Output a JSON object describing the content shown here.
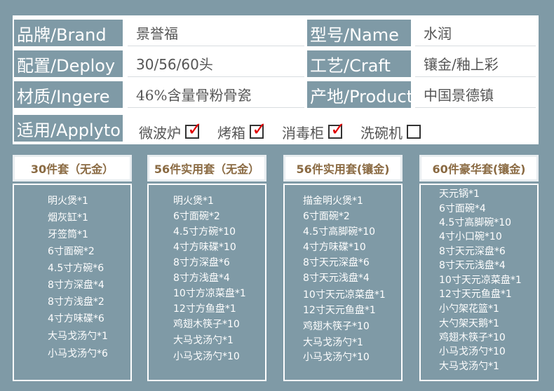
{
  "spec": {
    "brand": {
      "label": "品牌/Brand",
      "value": "景誉福"
    },
    "name": {
      "label": "型号/Name",
      "value": "水润"
    },
    "deploy": {
      "label": "配置/Deploy",
      "value": "30/56/60头"
    },
    "craft": {
      "label": "工艺/Craft",
      "value": "镶金/釉上彩"
    },
    "ingere": {
      "label": "材质/Ingere",
      "value": "46%含量骨粉骨瓷"
    },
    "product": {
      "label": "产地/Product",
      "value": "中国景德镇"
    },
    "applyto": {
      "label": "适用/Applyto",
      "options": [
        {
          "text": "微波炉",
          "checked": true
        },
        {
          "text": "烤箱",
          "checked": true
        },
        {
          "text": "消毒柜",
          "checked": true
        },
        {
          "text": "洗碗机",
          "checked": false
        }
      ]
    }
  },
  "sets": [
    {
      "title": "30件套（无金）",
      "items": [
        "明火煲*1",
        "烟灰缸*1",
        "牙签筒*1",
        "6寸面碗*2",
        "4.5寸方碗*6",
        "8寸方深盘*4",
        "8寸方浅盘*2",
        "4寸方味碟*6",
        "大马戈汤勺*1",
        "小马戈汤勺*6"
      ]
    },
    {
      "title": "56件实用套（无金）",
      "items": [
        "明火煲*1",
        "6寸面碗*2",
        "4.5寸方碗*10",
        "4寸方味碟*10",
        "8寸方深盘*6",
        "8寸方浅盘*4",
        "10寸方凉菜盘*1",
        "12寸方鱼盘*1",
        "鸡翅木筷子*10",
        "大马戈汤勺*1",
        "小马戈汤勺*10"
      ]
    },
    {
      "title": "56件实用套(镶金)",
      "items": [
        "描金明火煲*1",
        "6寸面碗*2",
        "4.5寸高脚碗*10",
        "4寸方味碟*10",
        "8寸天元深盘*6",
        "8寸天元浅盘*4",
        "10寸天元凉菜盘*1",
        "12寸天元鱼盘*1",
        "鸡翅木筷子*10",
        "大马戈汤勺*1",
        "小马戈汤勺*10"
      ]
    },
    {
      "title": "60件豪华套(镶金)",
      "items": [
        "天元锅*1",
        "6寸面碗*4",
        "4.5寸高脚碗*10",
        "4寸小口碗*10",
        "8寸天元深盘*6",
        "8寸天元浅盘*4",
        "10寸天元凉菜盘*1",
        "12寸天元鱼盘*1",
        "小勺架花篮*1",
        "大勺架天鹅*1",
        "鸡翅木筷子*10",
        "小马戈汤勺*10",
        "大马戈汤勺*1"
      ]
    }
  ]
}
